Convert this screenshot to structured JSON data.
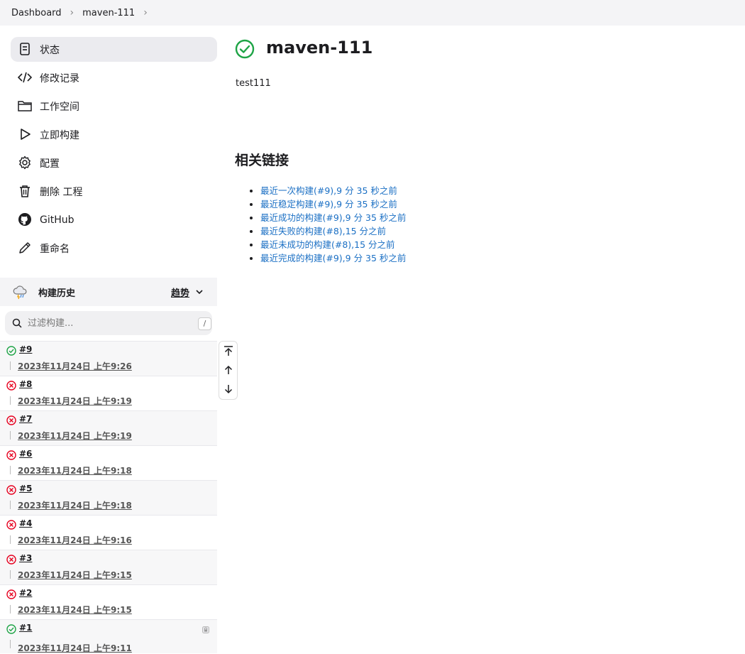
{
  "breadcrumb": [
    "Dashboard",
    "maven-111"
  ],
  "sidebar": {
    "items": [
      {
        "label": "状态",
        "icon": "document-icon"
      },
      {
        "label": "修改记录",
        "icon": "code-icon"
      },
      {
        "label": "工作空间",
        "icon": "folder-icon"
      },
      {
        "label": "立即构建",
        "icon": "play-icon"
      },
      {
        "label": "配置",
        "icon": "gear-icon"
      },
      {
        "label": "删除 工程",
        "icon": "trash-icon"
      },
      {
        "label": "GitHub",
        "icon": "github-icon"
      },
      {
        "label": "重命名",
        "icon": "pencil-icon"
      }
    ]
  },
  "history": {
    "title": "构建历史",
    "trend": "趋势",
    "filter_placeholder": "过滤构建...",
    "shortcut": "/",
    "builds": [
      {
        "num": "#9",
        "date": "2023年11月24日 上午9:26",
        "status": "success"
      },
      {
        "num": "#8",
        "date": "2023年11月24日 上午9:19",
        "status": "failed"
      },
      {
        "num": "#7",
        "date": "2023年11月24日 上午9:19",
        "status": "failed"
      },
      {
        "num": "#6",
        "date": "2023年11月24日 上午9:18",
        "status": "failed"
      },
      {
        "num": "#5",
        "date": "2023年11月24日 上午9:18",
        "status": "failed"
      },
      {
        "num": "#4",
        "date": "2023年11月24日 上午9:16",
        "status": "failed"
      },
      {
        "num": "#3",
        "date": "2023年11月24日 上午9:15",
        "status": "failed"
      },
      {
        "num": "#2",
        "date": "2023年11月24日 上午9:15",
        "status": "failed"
      },
      {
        "num": "#1",
        "date": "2023年11月24日 上午9:11",
        "status": "success"
      }
    ]
  },
  "main": {
    "title": "maven-111",
    "description": "test111",
    "links_title": "相关链接",
    "links": [
      "最近一次构建(#9),9 分 35 秒之前",
      "最近稳定构建(#9),9 分 35 秒之前",
      "最近成功的构建(#9),9 分 35 秒之前",
      "最近失败的构建(#8),15 分之前",
      "最近未成功的构建(#8),15 分之前",
      "最近完成的构建(#9),9 分 35 秒之前"
    ]
  },
  "colors": {
    "success": "#1ea446",
    "failed": "#e6001f",
    "link": "#1a6fc4"
  }
}
